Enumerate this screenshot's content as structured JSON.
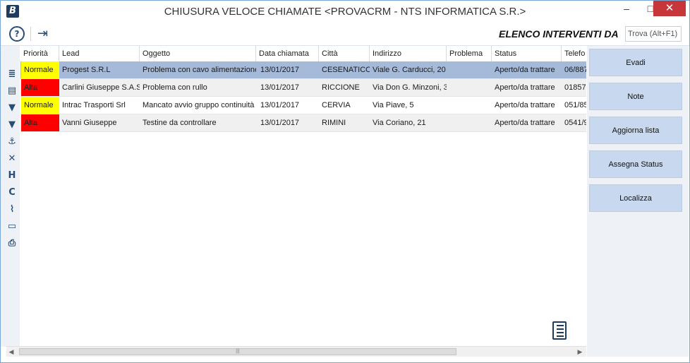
{
  "window": {
    "title": "CHIUSURA VELOCE CHIAMATE <PROVACRM - NTS INFORMATICA S.R.>",
    "app_icon": "B",
    "minimize": "–",
    "maximize": "□",
    "close": "✕"
  },
  "toolbar": {
    "help_icon": "?",
    "exit_icon": "⇥",
    "list_title": "ELENCO INTERVENTI DA",
    "find_value": "Trova (Alt+F1)"
  },
  "left_icons": [
    "≣",
    "▤",
    "▼",
    "▼",
    "⚓",
    "✕",
    "H",
    "C",
    "⌇",
    "▭",
    "⎙"
  ],
  "grid": {
    "columns": [
      "Priorità",
      "Lead",
      "Oggetto",
      "Data chiamata",
      "Città",
      "Indirizzo",
      "Problema",
      "Status",
      "Telefo"
    ],
    "rows": [
      [
        "Normale",
        "Progest S.R.L",
        "Problema con cavo alimentazione",
        "13/01/2017",
        "CESENATICO",
        "Viale G. Carducci, 20",
        "",
        "Aperto/da trattare",
        "06/887"
      ],
      [
        "Alta",
        "Carlini Giuseppe S.A.S",
        "Problema con rullo",
        "13/01/2017",
        "RICCIONE",
        "Via Don G. Minzoni, 3",
        "",
        "Aperto/da trattare",
        "01857"
      ],
      [
        "Normale",
        "Intrac Trasporti Srl",
        "Mancato avvio gruppo continuità",
        "13/01/2017",
        "CERVIA",
        "Via Piave, 5",
        "",
        "Aperto/da trattare",
        "051/85"
      ],
      [
        "Alta",
        "Vanni Giuseppe",
        "Testine da controllare",
        "13/01/2017",
        "RIMINI",
        "Via Coriano, 21",
        "",
        "Aperto/da trattare",
        "0541/9"
      ]
    ]
  },
  "scrollbar": {
    "left": "◀",
    "right": "▶",
    "grip": "|||"
  },
  "actions": {
    "evadi": "Evadi",
    "note": "Note",
    "aggiorna": "Aggiorna lista",
    "assegna": "Assegna Status",
    "localizza": "Localizza"
  },
  "colors": {
    "selected_row": "#a5b9d8",
    "priority_normale": "#ffff00",
    "priority_alta": "#ff0000",
    "action_button": "#c8d9ef",
    "close_button": "#c7373a",
    "icon_color": "#2a4d75"
  }
}
